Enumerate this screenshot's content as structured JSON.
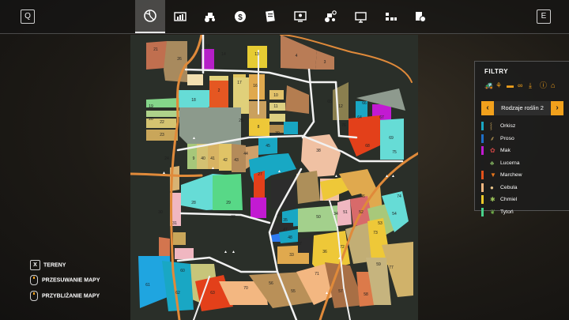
{
  "topbar": {
    "left_key": "Q",
    "right_key": "E",
    "tabs": [
      {
        "icon": "globe-icon",
        "active": true
      },
      {
        "icon": "chart-icon",
        "active": false
      },
      {
        "icon": "tractor-icon",
        "active": false
      },
      {
        "icon": "money-icon",
        "active": false
      },
      {
        "icon": "contracts-icon",
        "active": false
      },
      {
        "icon": "presentation-icon",
        "active": false
      },
      {
        "icon": "tractor-settings-icon",
        "active": false
      },
      {
        "icon": "monitor-icon",
        "active": false
      },
      {
        "icon": "production-icon",
        "active": false
      },
      {
        "icon": "finance-icon",
        "active": false
      }
    ]
  },
  "map": {
    "field_labels": [
      "21",
      "26",
      "15",
      "14",
      "13",
      "4",
      "3",
      "2",
      "18",
      "17",
      "16",
      "10",
      "11",
      "12",
      "65",
      "66",
      "64",
      "67",
      "68",
      "69",
      "19",
      "20",
      "22",
      "23",
      "24",
      "25",
      "8",
      "9",
      "40",
      "41",
      "42",
      "43",
      "44",
      "45",
      "39",
      "38",
      "27",
      "28",
      "29",
      "30",
      "31",
      "32",
      "35",
      "36",
      "37",
      "33",
      "34",
      "46",
      "47",
      "48",
      "49",
      "50",
      "51",
      "52",
      "53",
      "54",
      "55",
      "56",
      "57",
      "58",
      "59",
      "60",
      "61",
      "62",
      "63",
      "70",
      "71",
      "72",
      "73",
      "74",
      "75",
      "76",
      "77"
    ]
  },
  "filters": {
    "title": "FILTRY",
    "filter_icons": [
      "tractor-filter-icon",
      "seed-filter-icon",
      "trailer-filter-icon",
      "link-filter-icon",
      "download-filter-icon",
      "warning-filter-icon",
      "farmhouse-filter-icon"
    ],
    "selector": {
      "prev": "‹",
      "value": "Rodzaje roślin 2",
      "next": "›"
    },
    "legend": [
      {
        "label": "Orkisz",
        "color": "#19a7c4"
      },
      {
        "label": "Proso",
        "color": "#1f6fc7"
      },
      {
        "label": "Mak",
        "color": "#c21ad2"
      },
      {
        "label": "Lucerna",
        "color": "#1d1d1d"
      },
      {
        "label": "Marchew",
        "color": "#e3521a"
      },
      {
        "label": "Cebula",
        "color": "#f3b781"
      },
      {
        "label": "Chmiel",
        "color": "#eec92a"
      },
      {
        "label": "Tytoń",
        "color": "#48d28a"
      }
    ]
  },
  "hints": [
    {
      "key": "X",
      "label": "TERENY"
    },
    {
      "key": "",
      "label": "PRZESUWANIE MAPY"
    },
    {
      "key": "",
      "label": "PRZYBLIŻANIE MAPY"
    }
  ]
}
